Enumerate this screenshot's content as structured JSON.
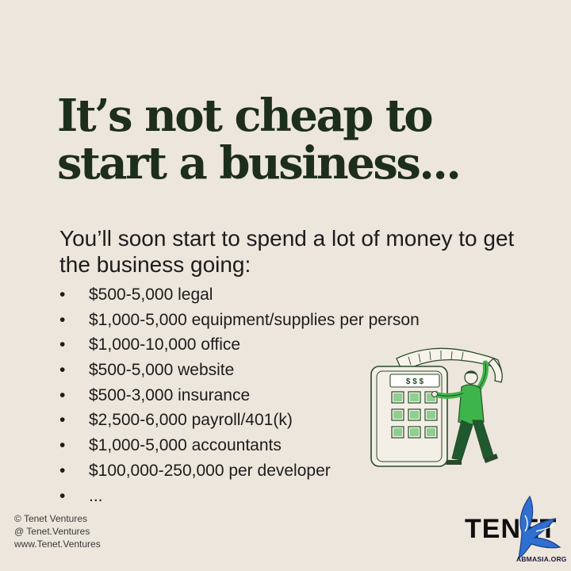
{
  "headline": {
    "line1": "It’s not cheap to",
    "line2": "start a business..."
  },
  "intro": "You’ll soon start to spend a lot of money to get the business going:",
  "bullet_char": "•",
  "costs": [
    "$500-5,000 legal",
    "$1,000-5,000 equipment/supplies per person",
    "$1,000-10,000 office",
    "$500-5,000 website",
    "$500-3,000 insurance",
    "$2,500-6,000 payroll/401(k)",
    "$1,000-5,000 accountants",
    "$100,000-250,000 per developer",
    "..."
  ],
  "illustration": {
    "icon": "calculator-person-receipt-icon",
    "display_text": "$ $ $",
    "colors": {
      "outline": "#2a4a2a",
      "shirt": "#3db54a",
      "pants": "#1f5a2e"
    }
  },
  "footer": {
    "copyright": "© Tenet Ventures",
    "handle": "@ Tenet.Ventures",
    "website": "www.Tenet.Ventures"
  },
  "brand": "TENET",
  "watermark": {
    "icon": "blue-bird-watermark-icon",
    "text": "ABMASIA.ORG"
  },
  "colors": {
    "background": "#ece6dc",
    "headline": "#1d2e1c",
    "accent_green": "#3db54a"
  }
}
